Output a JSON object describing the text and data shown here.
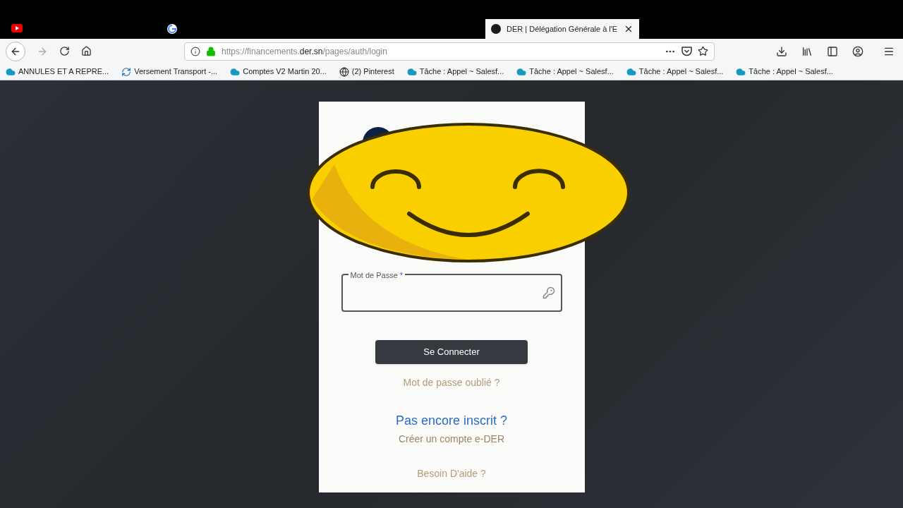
{
  "browser": {
    "tabs": [
      {
        "kind": "video",
        "selected": false
      },
      {
        "kind": "search",
        "selected": false
      },
      {
        "kind": "page",
        "title": "DER | Délégation Générale à l'E",
        "selected": true
      }
    ],
    "url": {
      "prefix": "https://financements.",
      "domain": "der.sn",
      "path": "/pages/auth/login"
    },
    "bookmarks": [
      {
        "kind": "cloud",
        "label": "ANNULES ET A REPRE..."
      },
      {
        "kind": "sync",
        "label": "Versement Transport -..."
      },
      {
        "kind": "cloud",
        "label": "Comptes V2 Martin 20..."
      },
      {
        "kind": "globe",
        "label": "(2) Pinterest"
      },
      {
        "kind": "cloud",
        "label": "Tâche : Appel ~ Salesf..."
      },
      {
        "kind": "cloud",
        "label": "Tâche : Appel ~ Salesf..."
      },
      {
        "kind": "cloud",
        "label": "Tâche : Appel ~ Salesf..."
      },
      {
        "kind": "cloud",
        "label": "Tâche : Appel ~ Salesf..."
      }
    ]
  },
  "login": {
    "password_label": "Mot de Passe",
    "required_mark": "*",
    "submit": "Se Connecter",
    "forgot": "Mot de passe oublié ?",
    "signup_question": "Pas encore inscrit ?",
    "signup_link": "Créer un compte e-DER",
    "help": "Besoin D'aide ?"
  }
}
